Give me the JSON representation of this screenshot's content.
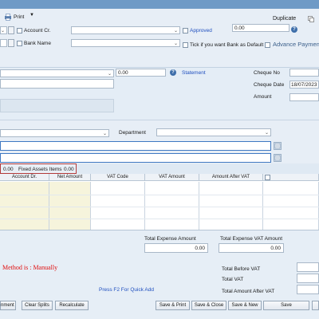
{
  "toolbar": {
    "print_label": "Print",
    "duplicate_label": "Duplicate"
  },
  "header": {
    "account_cr_label": "Account Cr.",
    "bank_name_label": "Bank Name",
    "approved_label": "Approved",
    "amount_value": "0.00",
    "tick_default_bank_label": "Tick if you want Bank as Default",
    "advance_payment_label": "Advance Payment"
  },
  "middle": {
    "amount_value": "0.00",
    "statement_label": "Statement",
    "cheque_no_label": "Cheque No",
    "cheque_date_label": "Cheque Date",
    "cheque_date_value": "18/07/2023",
    "amount_label": "Amount"
  },
  "dept": {
    "department_label": "Department"
  },
  "summary_box": {
    "first_value": "0.00",
    "fixed_assets_label": "Fixed Assets Items",
    "fixed_assets_value": "0.00"
  },
  "grid": {
    "columns": [
      "Account Dr.",
      "Net Amount",
      "VAT Code",
      "VAT Amount",
      "Amount After VAT"
    ]
  },
  "totals": {
    "total_expense_amount_label": "Total Expense Amount",
    "total_expense_amount_value": "0.00",
    "total_expense_vat_label": "Total Expense VAT Amount",
    "total_expense_vat_value": "0.00",
    "method_text": "Method is : Manually",
    "quick_add_text": "Press F2 For Quick Add",
    "total_before_vat_label": "Total Before VAT",
    "total_vat_label": "Total VAT",
    "total_after_vat_label": "Total Amount After VAT"
  },
  "buttons": {
    "attachment": "nment",
    "clear_splits": "Clear Splits",
    "recalculate": "Recalculate",
    "save_print": "Save & Print",
    "save_close": "Save & Close",
    "save_new": "Save & New",
    "save": "Save"
  },
  "colors": {
    "accent_blue": "#1f4fbf",
    "method_red": "#e01010",
    "highlight_box": "#b33a3a"
  }
}
